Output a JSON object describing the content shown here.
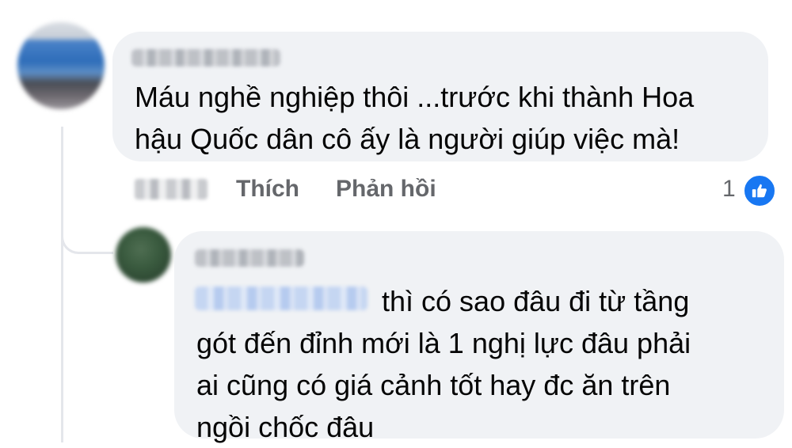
{
  "comment": {
    "text": "Máu nghề nghiệp thôi ...trước khi thành Hoa hậu Quốc dân cô ấy là người giúp việc mà!",
    "line1": "Máu nghề nghiệp thôi ...trước khi thành Hoa",
    "line2": "hậu Quốc dân cô ấy là người giúp việc mà!",
    "actions": {
      "like_label": "Thích",
      "reply_label": "Phản hồi",
      "reaction_count": "1",
      "reaction_icon": "thumbs-up-icon"
    }
  },
  "reply": {
    "line1": "thì có sao đâu đi từ tầng",
    "line2": "gót đến đỉnh mới là 1 nghị lực đâu phải",
    "line3": "ai cũng có giá cảnh tốt hay đc ăn trên",
    "line4": "ngồi chốc đâu"
  },
  "colors": {
    "bubble": "#f0f2f5",
    "action_text": "#65676b",
    "like_badge": "#1877f2",
    "mention": "#216fdb"
  }
}
